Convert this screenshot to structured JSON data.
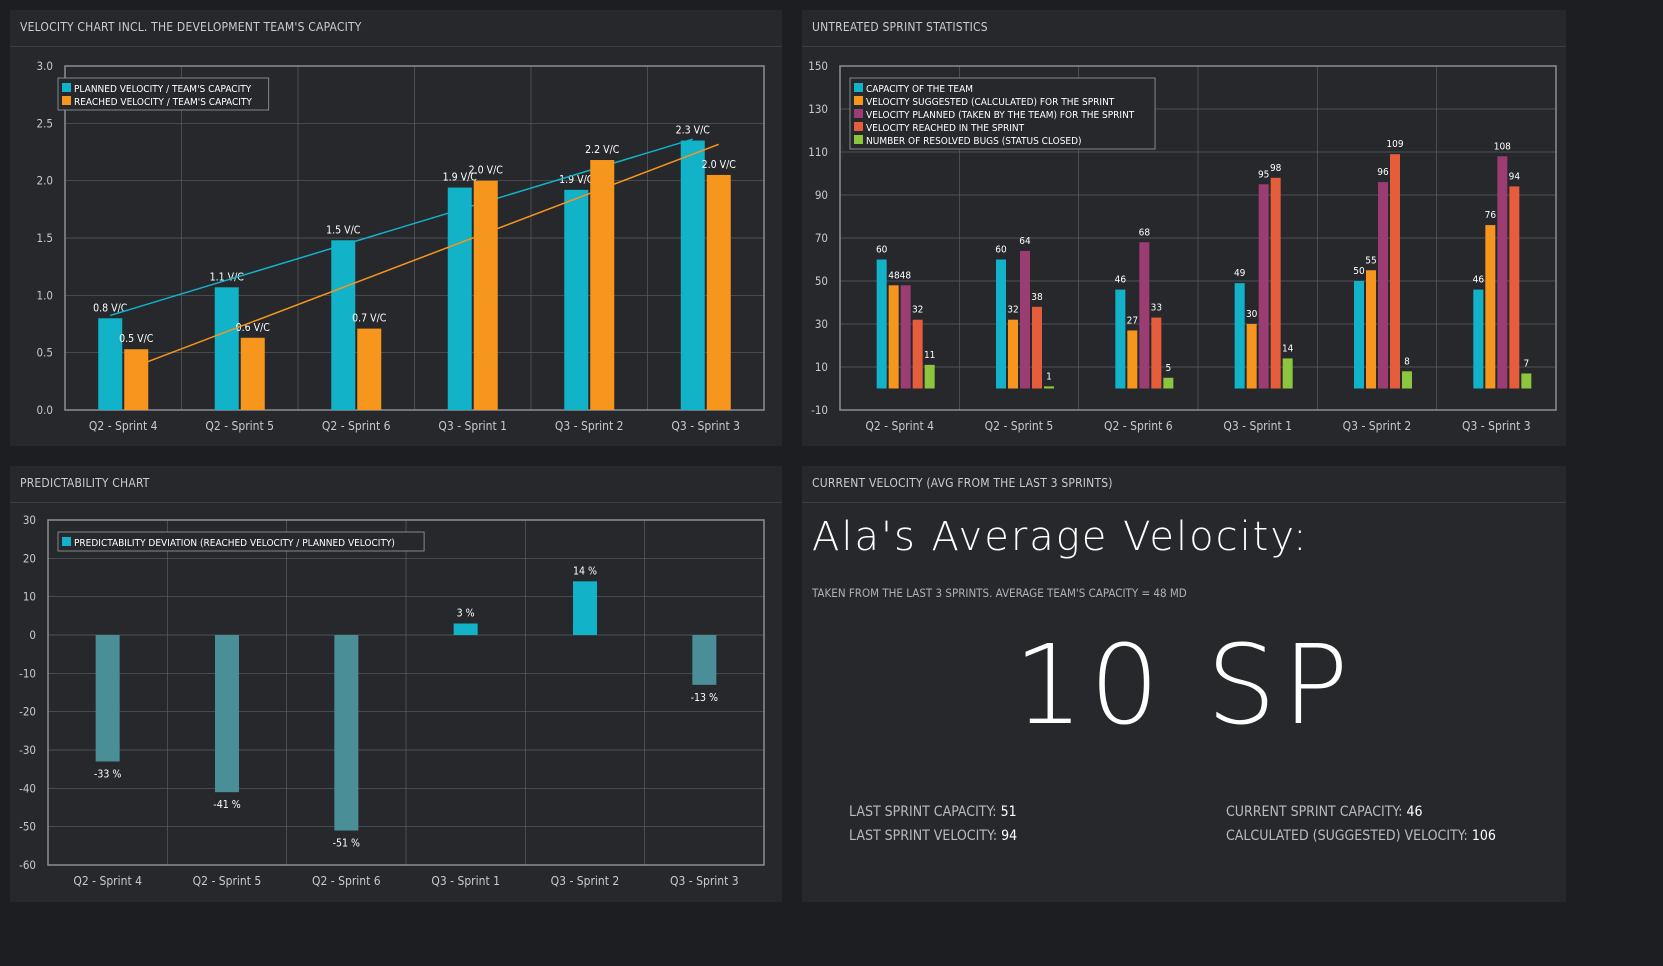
{
  "panels": {
    "velocity": {
      "title": "VELOCITY CHART INCL. THE DEVELOPMENT TEAM'S CAPACITY"
    },
    "untreated": {
      "title": "UNTREATED SPRINT STATISTICS"
    },
    "predictability": {
      "title": "PREDICTABILITY CHART"
    },
    "current": {
      "title": "CURRENT VELOCITY (AVG FROM THE LAST 3 SPRINTS)",
      "heading": "Ala's Average Velocity:",
      "subheading": "TAKEN FROM THE LAST 3 SPRINTS. AVERAGE TEAM'S CAPACITY = 48 MD",
      "value": "10 SP",
      "stats": {
        "last_capacity_label": "LAST SPRINT CAPACITY:",
        "last_capacity_value": "51",
        "last_velocity_label": "LAST SPRINT VELOCITY:",
        "last_velocity_value": "94",
        "current_capacity_label": "CURRENT SPRINT CAPACITY:",
        "current_capacity_value": "46",
        "calculated_velocity_label": "CALCULATED (SUGGESTED) VELOCITY:",
        "calculated_velocity_value": "106"
      }
    }
  },
  "colors": {
    "cyan": "#12b2c9",
    "orange": "#f7961d",
    "purple": "#9b3d72",
    "red": "#e55d3a",
    "green": "#8cc63f",
    "teal_negative": "#4a8f97",
    "grid": "#5a5e64",
    "frame": "#8a8e94"
  },
  "chart_data": [
    {
      "type": "bar",
      "categories": [
        "Q2 - Sprint 4",
        "Q2 - Sprint 5",
        "Q2 - Sprint 6",
        "Q3 - Sprint 1",
        "Q3 - Sprint 2",
        "Q3 - Sprint 3"
      ],
      "ylim": [
        0,
        3
      ],
      "yticks": [
        "0.0",
        "0.5",
        "1.0",
        "1.5",
        "2.0",
        "2.5",
        "3.0"
      ],
      "legend": "top-left",
      "grid": true,
      "trendlines": true,
      "series": [
        {
          "name": "PLANNED VELOCITY / TEAM'S CAPACITY",
          "color": "cyan",
          "values": [
            0.8,
            1.07,
            1.48,
            1.94,
            1.92,
            2.35
          ],
          "labels": [
            "0.8 V/C",
            "1.1 V/C",
            "1.5 V/C",
            "1.9 V/C",
            "1.9 V/C",
            "2.3 V/C"
          ]
        },
        {
          "name": "REACHED VELOCITY / TEAM'S CAPACITY",
          "color": "orange",
          "values": [
            0.53,
            0.63,
            0.71,
            2.0,
            2.18,
            2.05
          ],
          "labels": [
            "0.5 V/C",
            "0.6 V/C",
            "0.7 V/C",
            "2.0 V/C",
            "2.2 V/C",
            "2.0 V/C"
          ]
        }
      ]
    },
    {
      "type": "bar",
      "categories": [
        "Q2 - Sprint 4",
        "Q2 - Sprint 5",
        "Q2 - Sprint 6",
        "Q3 - Sprint 1",
        "Q3 - Sprint 2",
        "Q3 - Sprint 3"
      ],
      "ylim": [
        -10,
        150
      ],
      "yticks": [
        "-10",
        "10",
        "30",
        "50",
        "70",
        "90",
        "110",
        "130",
        "150"
      ],
      "legend": "top-left",
      "grid": true,
      "series": [
        {
          "name": "CAPACITY OF THE TEAM",
          "color": "cyan",
          "values": [
            60,
            60,
            46,
            49,
            50,
            46
          ]
        },
        {
          "name": "VELOCITY SUGGESTED (CALCULATED) FOR THE SPRINT",
          "color": "orange",
          "values": [
            48,
            32,
            27,
            30,
            55,
            76
          ]
        },
        {
          "name": "VELOCITY PLANNED (TAKEN BY THE TEAM) FOR THE SPRINT",
          "color": "purple",
          "values": [
            48,
            64,
            68,
            95,
            96,
            108
          ]
        },
        {
          "name": "VELOCITY REACHED IN THE SPRINT",
          "color": "red",
          "values": [
            32,
            38,
            33,
            98,
            109,
            94
          ]
        },
        {
          "name": "NUMBER OF RESOLVED BUGS (STATUS CLOSED)",
          "color": "green",
          "values": [
            11,
            1,
            5,
            14,
            8,
            7
          ]
        }
      ],
      "label_overrides": {
        "0": "4848"
      }
    },
    {
      "type": "bar",
      "categories": [
        "Q2 - Sprint 4",
        "Q2 - Sprint 5",
        "Q2 - Sprint 6",
        "Q3 - Sprint 1",
        "Q3 - Sprint 2",
        "Q3 - Sprint 3"
      ],
      "ylim": [
        -60,
        30
      ],
      "yticks": [
        "-60",
        "-50",
        "-40",
        "-30",
        "-20",
        "-10",
        "0",
        "10",
        "20",
        "30"
      ],
      "legend": "top-left",
      "grid": true,
      "series": [
        {
          "name": "PREDICTABILITY DEVIATION (REACHED VELOCITY / PLANNED VELOCITY)",
          "color": "cyan",
          "values": [
            -33,
            -41,
            -51,
            3,
            14,
            -13
          ],
          "labels": [
            "-33 %",
            "-41 %",
            "-51 %",
            "3 %",
            "14 %",
            "-13 %"
          ]
        }
      ]
    }
  ]
}
